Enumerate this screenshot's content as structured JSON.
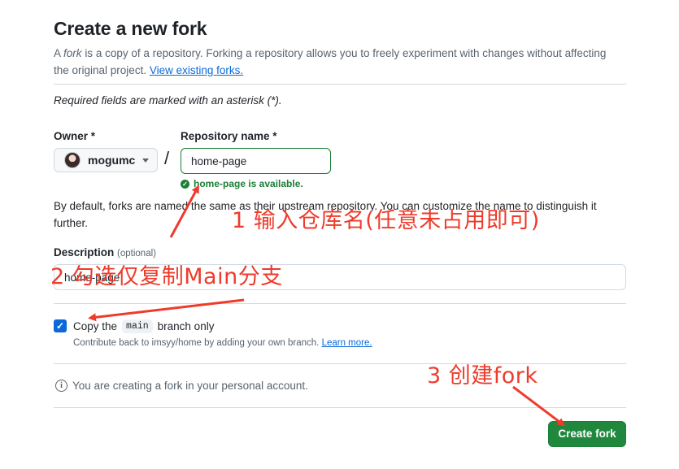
{
  "header": {
    "title": "Create a new fork",
    "subtitle_prefix": "A",
    "subtitle_fork_word": "fork",
    "subtitle_text": "is a copy of a repository. Forking a repository allows you to freely experiment with changes without affecting the original project.",
    "view_forks_link": "View existing forks."
  },
  "form": {
    "required_note": "Required fields are marked with an asterisk (*).",
    "owner_label": "Owner *",
    "owner_value": "mogumc",
    "slash": "/",
    "repo_label": "Repository name *",
    "repo_value": "home-page",
    "availability": "home-page is available.",
    "default_note": "By default, forks are named the same as their upstream repository. You can customize the name to distinguish it further.",
    "description_label": "Description",
    "description_optional": "(optional)",
    "description_value": "home-page",
    "copy_checked": true,
    "copy_label_before": "Copy the",
    "copy_branch": "main",
    "copy_label_after": "branch only",
    "copy_hint": "Contribute back to imsyy/home by adding your own branch.",
    "learn_more": "Learn more.",
    "info_text": "You are creating a fork in your personal account.",
    "create_button": "Create fork"
  },
  "annotations": {
    "step1": "1 输入仓库名(任意未占用即可)",
    "step2": "2 勾选仅复制Main分支",
    "step3": "3 创建fork"
  },
  "colors": {
    "annotation": "#ee3b2b",
    "primary_button": "#1f883d",
    "link": "#0969da",
    "success": "#1a7f37"
  }
}
